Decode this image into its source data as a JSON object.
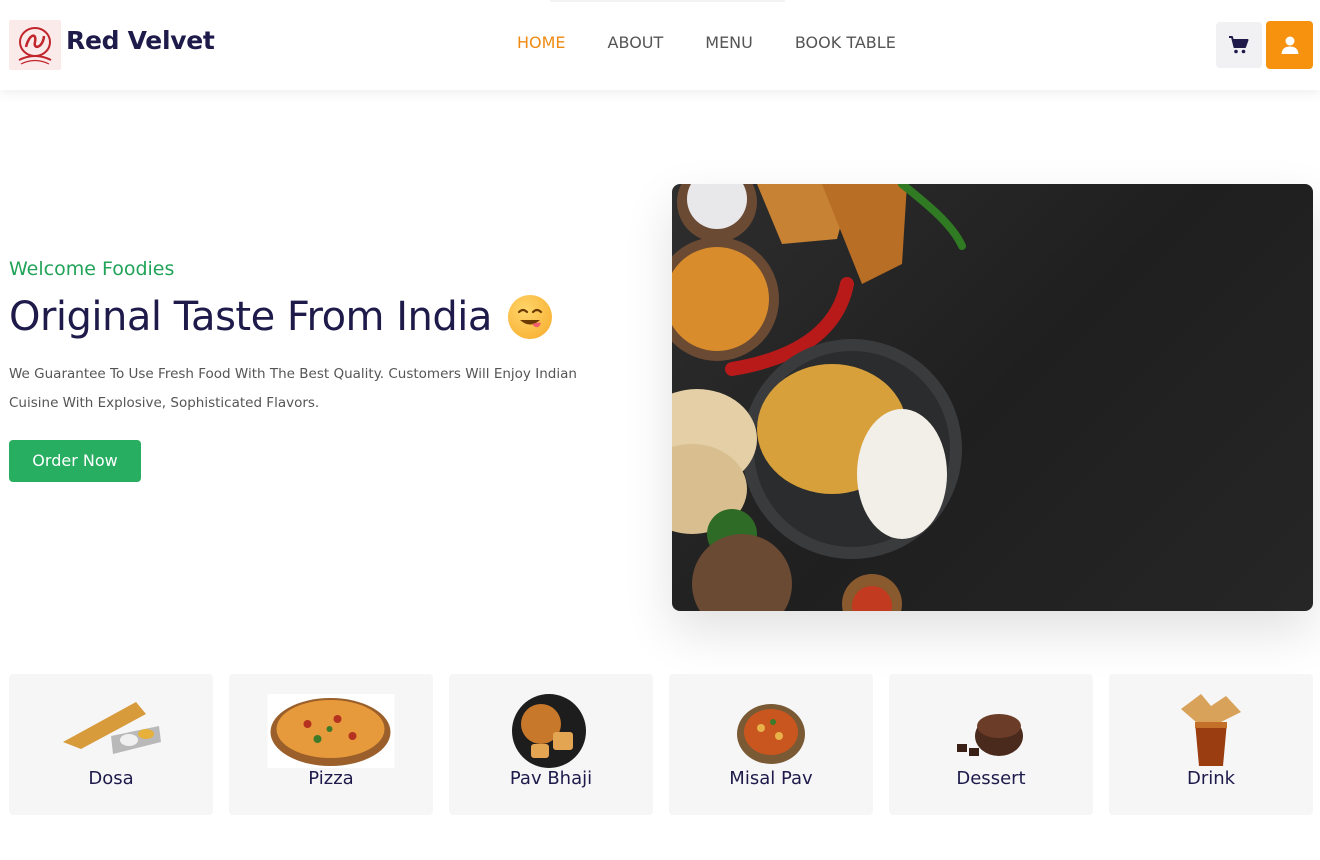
{
  "header": {
    "brand": "Red Velvet",
    "nav": [
      {
        "label": "HOME",
        "active": true
      },
      {
        "label": "ABOUT",
        "active": false
      },
      {
        "label": "MENU",
        "active": false
      },
      {
        "label": "BOOK TABLE",
        "active": false
      }
    ],
    "icons": {
      "cart": "cart-icon",
      "user": "user-icon",
      "logo": "red-velvet-logo"
    }
  },
  "hero": {
    "subtitle": "Welcome Foodies",
    "title": "Original Taste From India",
    "emoji": "yum-face-emoji",
    "description": "We Guarantee To Use Fresh Food With The Best Quality. Customers Will Enjoy Indian Cuisine With Explosive, Sophisticated Flavors.",
    "cta": "Order Now",
    "image": "indian-food-spread-photo"
  },
  "categories": [
    {
      "label": "Dosa",
      "image": "dosa-plate"
    },
    {
      "label": "Pizza",
      "image": "pizza"
    },
    {
      "label": "Pav Bhaji",
      "image": "pav-bhaji-bowl"
    },
    {
      "label": "Misal Pav",
      "image": "misal-pav-pot"
    },
    {
      "label": "Dessert",
      "image": "chocolate-cake"
    },
    {
      "label": "Drink",
      "image": "cola-glass"
    }
  ],
  "colors": {
    "accent": "#f08a12",
    "green": "#27ae60",
    "navy": "#1e1b4b",
    "user_btn": "#f6920d"
  }
}
